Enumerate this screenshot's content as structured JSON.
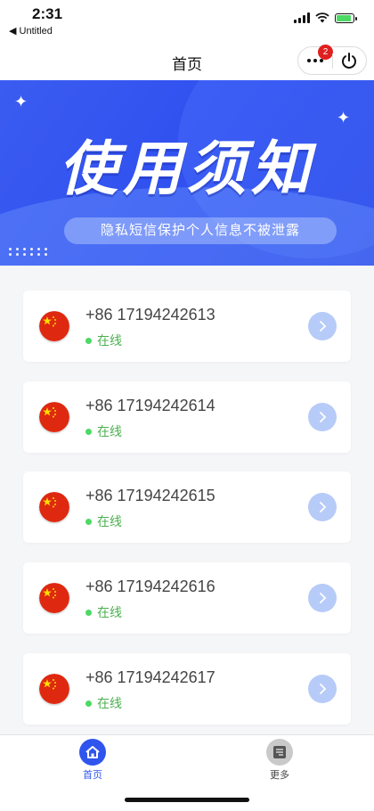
{
  "status_bar": {
    "time": "2:31",
    "back_label": "◀ Untitled"
  },
  "navbar": {
    "title": "首页",
    "badge_count": "2"
  },
  "banner": {
    "title": "使用须知",
    "subtitle": "隐私短信保护个人信息不被泄露"
  },
  "numbers": [
    {
      "phone": "+86 17194242613",
      "status": "在线"
    },
    {
      "phone": "+86 17194242614",
      "status": "在线"
    },
    {
      "phone": "+86 17194242615",
      "status": "在线"
    },
    {
      "phone": "+86 17194242616",
      "status": "在线"
    },
    {
      "phone": "+86 17194242617",
      "status": "在线"
    }
  ],
  "tabbar": {
    "home_label": "首页",
    "more_label": "更多"
  },
  "colors": {
    "accent": "#2f55ee",
    "online": "#4caf50",
    "badge": "#e02020",
    "flag_red": "#de2910",
    "flag_star": "#ffde00"
  }
}
